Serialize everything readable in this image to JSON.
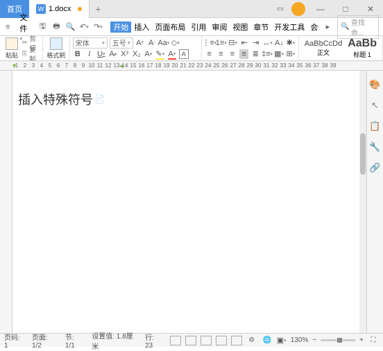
{
  "titlebar": {
    "home_tab": "首页",
    "doc_name": "1.docx"
  },
  "menubar": {
    "file": "文件",
    "tabs": [
      "开始",
      "插入",
      "页面布局",
      "引用",
      "审阅",
      "视图",
      "章节",
      "开发工具",
      "会"
    ],
    "search_placeholder": "查找命..."
  },
  "ribbon": {
    "paste": "粘贴",
    "cut": "剪切",
    "copy": "复制",
    "format_painter": "格式刷",
    "font_name": "宋体",
    "font_size": "五号",
    "style_normal_preview": "AaBbCcDd",
    "style_normal_label": "正文",
    "style_heading_preview": "AaBb",
    "style_heading_label": "标题 1"
  },
  "ruler_numbers": [
    "1",
    "2",
    "3",
    "4",
    "5",
    "6",
    "7",
    "8",
    "9",
    "10",
    "11",
    "12",
    "13",
    "14",
    "15",
    "16",
    "17",
    "18",
    "19",
    "20",
    "21",
    "22",
    "23",
    "24",
    "25",
    "26",
    "27",
    "28",
    "29",
    "30",
    "31",
    "32",
    "33",
    "34",
    "35",
    "36",
    "37",
    "38",
    "39"
  ],
  "document": {
    "text": "插入特殊符号"
  },
  "statusbar": {
    "page_label": "页码: 1",
    "page_of": "页面: 1/2",
    "section": "节: 1/1",
    "pos": "设置值: 1.8厘米",
    "line": "行: 23",
    "zoom": "130%"
  }
}
